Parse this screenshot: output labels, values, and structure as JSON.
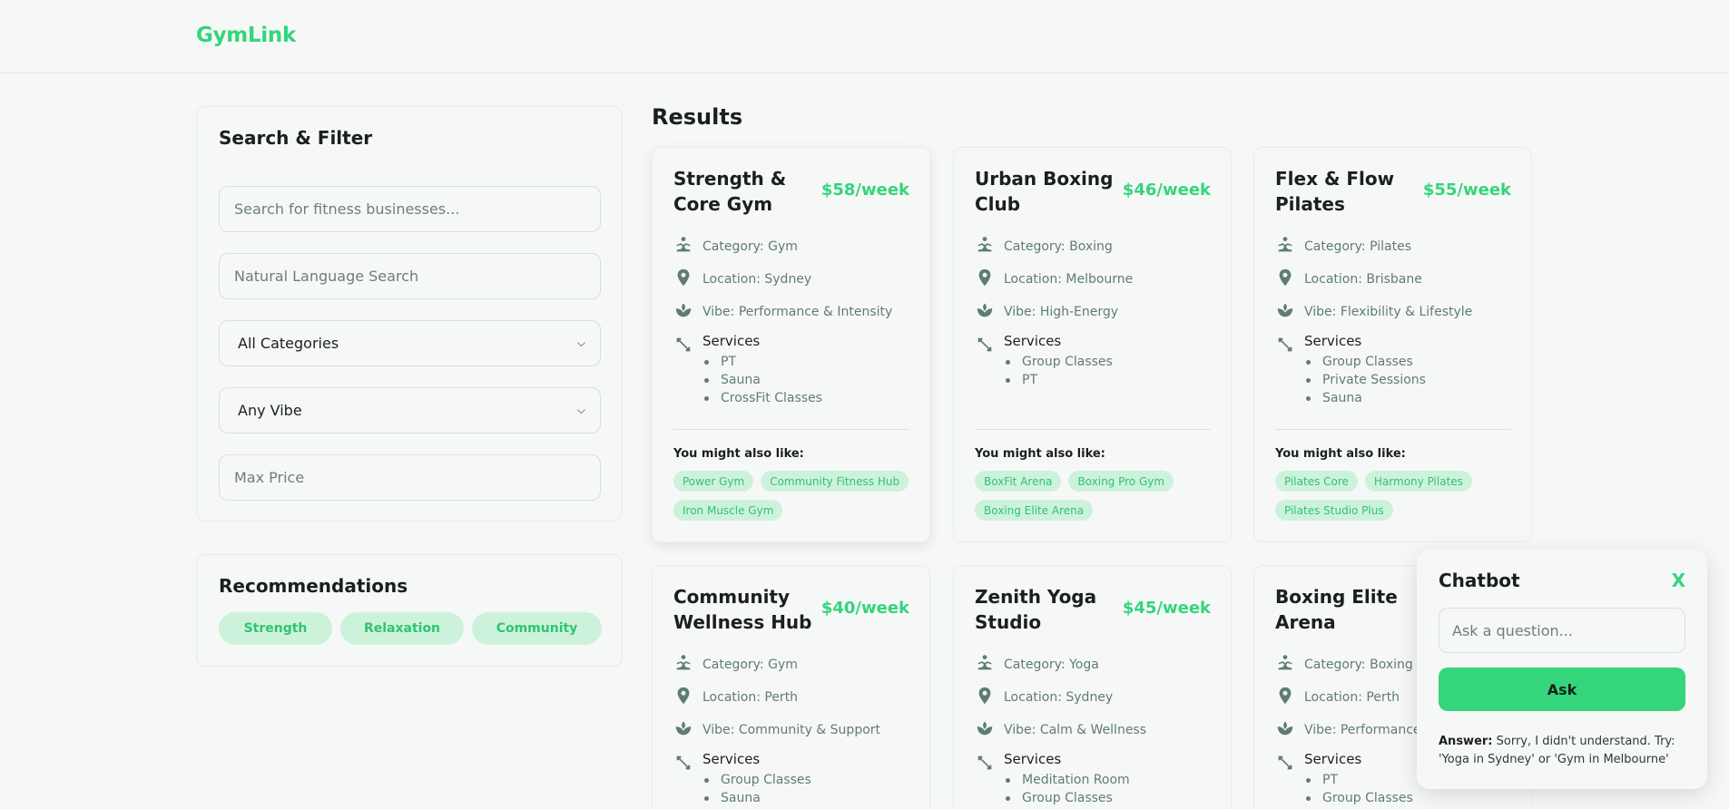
{
  "header": {
    "brand": "GymLink"
  },
  "filter": {
    "title": "Search & Filter",
    "search_placeholder": "Search for fitness businesses...",
    "nl_placeholder": "Natural Language Search",
    "category_selected": "All Categories",
    "vibe_selected": "Any Vibe",
    "price_placeholder": "Max Price"
  },
  "recommendations": {
    "title": "Recommendations",
    "items": [
      "Strength",
      "Relaxation",
      "Community"
    ]
  },
  "results": {
    "title": "Results",
    "services_label": "Services",
    "also_like_label": "You might also like:",
    "cards": [
      {
        "name": "Strength & Core Gym",
        "price": "$58/week",
        "category": "Category: Gym",
        "location": "Location: Sydney",
        "vibe": "Vibe: Performance & Intensity",
        "services": [
          "PT",
          "Sauna",
          "CrossFit Classes"
        ],
        "also_like": [
          "Power Gym",
          "Community Fitness Hub",
          "Iron Muscle Gym"
        ]
      },
      {
        "name": "Urban Boxing Club",
        "price": "$46/week",
        "category": "Category: Boxing",
        "location": "Location: Melbourne",
        "vibe": "Vibe: High-Energy",
        "services": [
          "Group Classes",
          "PT"
        ],
        "also_like": [
          "BoxFit Arena",
          "Boxing Pro Gym",
          "Boxing Elite Arena"
        ]
      },
      {
        "name": "Flex & Flow Pilates",
        "price": "$55/week",
        "category": "Category: Pilates",
        "location": "Location: Brisbane",
        "vibe": "Vibe: Flexibility & Lifestyle",
        "services": [
          "Group Classes",
          "Private Sessions",
          "Sauna"
        ],
        "also_like": [
          "Pilates Core",
          "Harmony Pilates",
          "Pilates Studio Plus"
        ]
      },
      {
        "name": "Community Wellness Hub",
        "price": "$40/week",
        "category": "Category: Gym",
        "location": "Location: Perth",
        "vibe": "Vibe: Community & Support",
        "services": [
          "Group Classes",
          "Sauna"
        ]
      },
      {
        "name": "Zenith Yoga Studio",
        "price": "$45/week",
        "category": "Category: Yoga",
        "location": "Location: Sydney",
        "vibe": "Vibe: Calm & Wellness",
        "services": [
          "Meditation Room",
          "Group Classes"
        ]
      },
      {
        "name": "Boxing Elite Arena",
        "price": "",
        "category": "Category: Boxing",
        "location": "Location: Perth",
        "vibe": "Vibe: Performance &",
        "services": [
          "PT",
          "Group Classes"
        ]
      }
    ]
  },
  "chatbot": {
    "title": "Chatbot",
    "close_label": "X",
    "input_placeholder": "Ask a question...",
    "ask_label": "Ask",
    "answer_label": "Answer:",
    "answer_text": "Sorry, I didn't understand. Try: 'Yoga in Sydney' or 'Gym in Melbourne'"
  },
  "colors": {
    "accent": "#34d57b",
    "pill_bg": "#cdf2dc",
    "icon": "#5f7d6f",
    "background": "#f6f8f7"
  }
}
